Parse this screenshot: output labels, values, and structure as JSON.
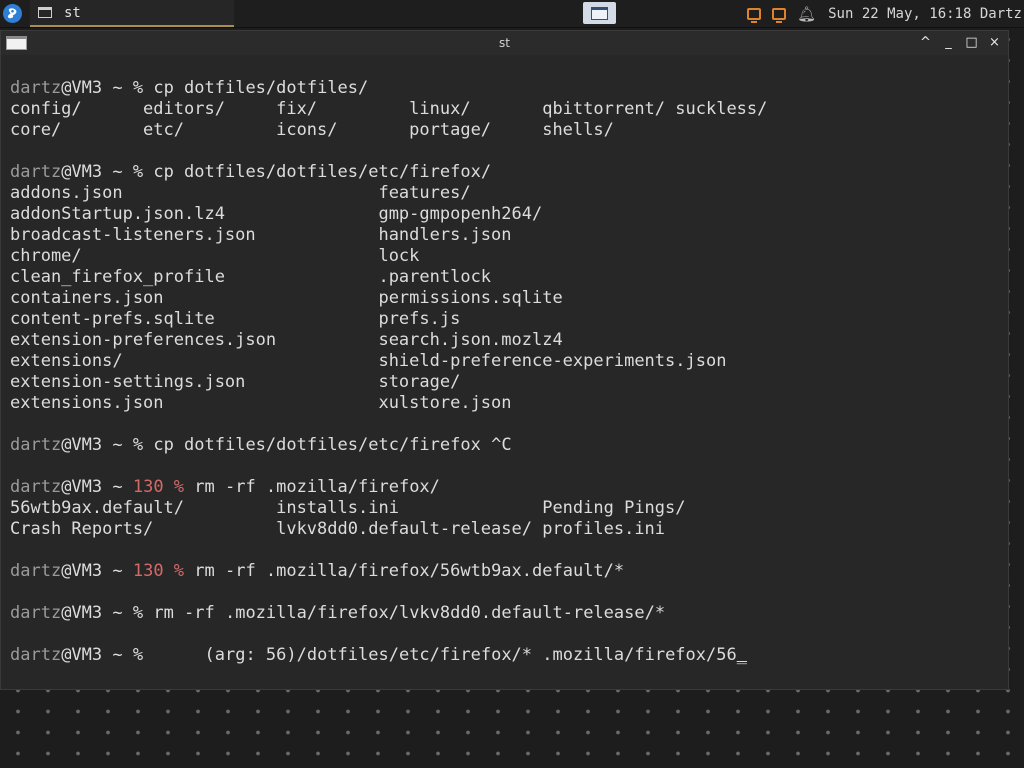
{
  "panel": {
    "task_label": "st",
    "clock": "Sun 22 May, 16:18 Dartz"
  },
  "window": {
    "title": "st",
    "buttons": [
      "^",
      "_",
      "□",
      "×"
    ]
  },
  "terminal": {
    "prompt_user": "dartz",
    "prompt_host": "@VM3 ~ ",
    "prompt_sym": "% ",
    "lines": [
      {
        "type": "blank"
      },
      {
        "type": "prompt",
        "cmd": "cp dotfiles/dotfiles/"
      },
      {
        "type": "out",
        "text": "config/      editors/     fix/         linux/       qbittorrent/ suckless/"
      },
      {
        "type": "out",
        "text": "core/        etc/         icons/       portage/     shells/"
      },
      {
        "type": "blank"
      },
      {
        "type": "prompt",
        "cmd": "cp dotfiles/dotfiles/etc/firefox/"
      },
      {
        "type": "out",
        "text": "addons.json                         features/"
      },
      {
        "type": "out",
        "text": "addonStartup.json.lz4               gmp-gmpopenh264/"
      },
      {
        "type": "out",
        "text": "broadcast-listeners.json            handlers.json"
      },
      {
        "type": "out",
        "text": "chrome/                             lock"
      },
      {
        "type": "out",
        "text": "clean_firefox_profile               .parentlock"
      },
      {
        "type": "out",
        "text": "containers.json                     permissions.sqlite"
      },
      {
        "type": "out",
        "text": "content-prefs.sqlite                prefs.js"
      },
      {
        "type": "out",
        "text": "extension-preferences.json          search.json.mozlz4"
      },
      {
        "type": "out",
        "text": "extensions/                         shield-preference-experiments.json"
      },
      {
        "type": "out",
        "text": "extension-settings.json             storage/"
      },
      {
        "type": "out",
        "text": "extensions.json                     xulstore.json"
      },
      {
        "type": "blank"
      },
      {
        "type": "prompt",
        "cmd": "cp dotfiles/dotfiles/etc/firefox ^C"
      },
      {
        "type": "blank"
      },
      {
        "type": "prompt",
        "status": "130 ",
        "cmd": "rm -rf .mozilla/firefox/"
      },
      {
        "type": "out",
        "text": "56wtb9ax.default/         installs.ini              Pending Pings/"
      },
      {
        "type": "out",
        "text": "Crash Reports/            lvkv8dd0.default-release/ profiles.ini"
      },
      {
        "type": "blank"
      },
      {
        "type": "prompt",
        "status": "130 ",
        "cmd": "rm -rf .mozilla/firefox/56wtb9ax.default/*"
      },
      {
        "type": "blank"
      },
      {
        "type": "prompt",
        "cmd": "rm -rf .mozilla/firefox/lvkv8dd0.default-release/*"
      },
      {
        "type": "blank"
      },
      {
        "type": "prompt",
        "cmd": "     (arg: 56)/dotfiles/etc/firefox/* .mozilla/firefox/56",
        "cursor": "_"
      }
    ]
  }
}
